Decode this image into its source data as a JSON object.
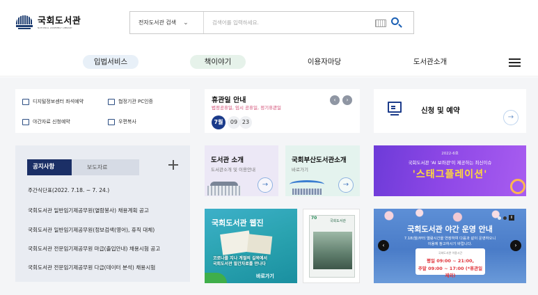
{
  "header": {
    "logo_ko": "국회도서관",
    "logo_en": "NATIONAL ASSEMBLY LIBRARY",
    "search": {
      "scope": "전자도서관 검색",
      "placeholder": "검색어를 입력하세요."
    }
  },
  "nav": {
    "items": [
      "입법서비스",
      "책이야기",
      "이용자마당",
      "도서관소개"
    ],
    "accent_blue": "#e8f0f8",
    "accent_green": "#e6f2ea"
  },
  "quick_links": [
    {
      "label": "디지털정보센터 좌석예약",
      "icon": "calendar-icon"
    },
    {
      "label": "협정기관 PC인증",
      "icon": "monitor-icon"
    },
    {
      "label": "야간자료 신청예약",
      "icon": "book-icon"
    },
    {
      "label": "우편복사",
      "icon": "mail-icon"
    }
  ],
  "closing": {
    "title": "휴관일 안내",
    "subtitle": "법정공휴일, 임시 공휴일, 정기휴관일",
    "month": "7월",
    "days": [
      "09",
      "23"
    ],
    "prev": "‹",
    "next": "›"
  },
  "apply": {
    "title": "신청 및 예약",
    "arrow": "→"
  },
  "notice": {
    "tabs": [
      "공지사항",
      "보도자료"
    ],
    "more": "+",
    "items": [
      "주간식단표(2022. 7.18. ~ 7. 24.)",
      "국회도서관 일반임기제공무원(열람봉사) 채용계획 공고",
      "국회도서관 일반임기제공무원(정보검색(영어), 휴직 대체)",
      "국회도서관 전문임기제공무원 마급(출입안내) 채용시험 공고",
      "국회도서관 전문임기제공무원 다급(데이터 분석) 채용시험"
    ]
  },
  "tiles": [
    {
      "title": "도서관 소개",
      "subtitle": "도서관소개 및 이용안내",
      "arrow": "→",
      "bg": "#ece8f6"
    },
    {
      "title": "국회부산도서관소개",
      "subtitle": "바로가기",
      "arrow": "→",
      "bg": "#e4f3ee"
    }
  ],
  "banners": {
    "purple": {
      "line1": "2022-6호",
      "line2": "국회도서관 'AI 보좌관'이 제공하는 최신이슈",
      "line3": "'스태그플레이션'"
    },
    "web": {
      "title": "국회도서관 웹진",
      "line1": "코로나를 지나 계절의 길목에서",
      "line2": "국회도서관 발간자료를 만나다",
      "cta": "바로가기"
    },
    "book": {
      "num": "70",
      "title": "국회도서관"
    },
    "night": {
      "title": "국회도서관 야간 운영 안내",
      "line1": "7.18(월)부터 열람시간을 연장하여 다음과 같이 운영하오니",
      "line2": "이용에 참고하시기 바랍니다.",
      "box_label": "국회도서관 이용시간",
      "weekday": "평일 09:00 ~ 21:00,",
      "weekend": "주말 09:00 ~ 17:00 (*휴관일 제외)",
      "prev": "‹",
      "next": "›",
      "pause": "II"
    }
  },
  "colors": {
    "navy": "#1b2f66",
    "closing_red": "#d0466f",
    "banner_purple": "#7b3fe0",
    "night_blue": "#4a7cc8"
  }
}
